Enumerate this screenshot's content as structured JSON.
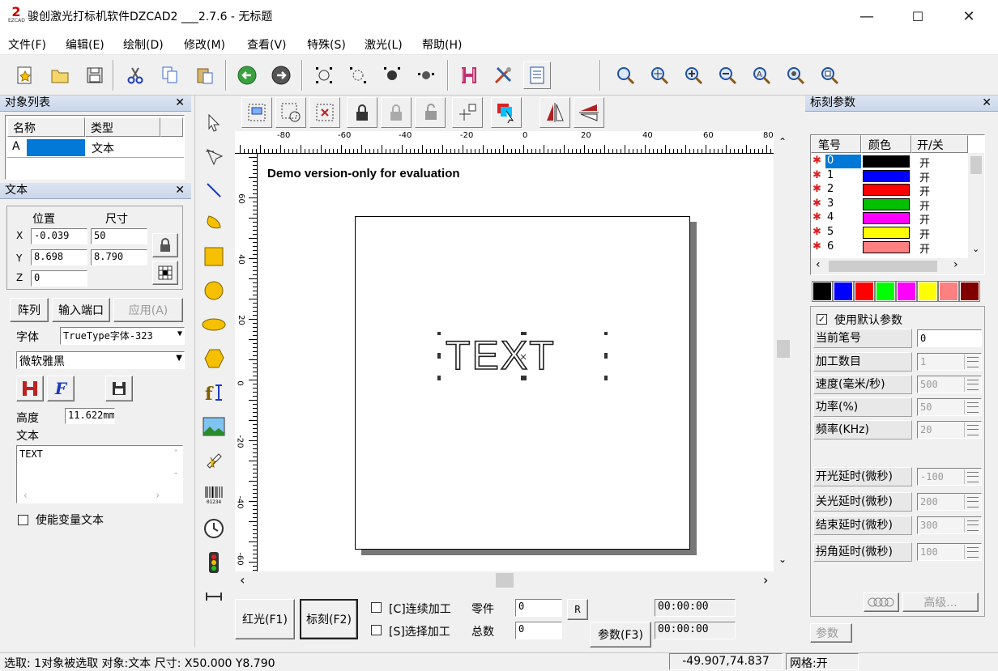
{
  "app": {
    "title": "骏创激光打标机软件DZCAD2 ___2.7.6 - 无标题",
    "logo_text": "EZCAD"
  },
  "window_buttons": {
    "minimize": "—",
    "maximize": "☐",
    "close": "✕"
  },
  "menu": [
    "文件(F)",
    "编辑(E)",
    "绘制(D)",
    "修改(M)",
    "查看(V)",
    "特殊(S)",
    "激光(L)",
    "帮助(H)"
  ],
  "object_list": {
    "title": "对象列表",
    "columns": [
      "名称",
      "类型"
    ],
    "rows": [
      {
        "name": "A",
        "type": "文本"
      }
    ]
  },
  "text_panel": {
    "title": "文本",
    "position_label": "位置",
    "size_label": "尺寸",
    "x_label": "X",
    "y_label": "Y",
    "z_label": "Z",
    "x_value": "-0.039",
    "y_value": "8.698",
    "z_value": "0",
    "size_x": "50",
    "size_y": "8.790",
    "array_button": "阵列",
    "input_port_button": "输入端口",
    "apply_button": "应用(A)",
    "font_label": "字体",
    "font_type": "TrueType字体-323",
    "font_name": "微软雅黑",
    "height_label": "高度",
    "height_value": "11.622mm",
    "text_label": "文本",
    "text_content": "TEXT",
    "variable_text_label": "使能变量文本"
  },
  "canvas": {
    "demo_text": "Demo version-only for evaluation",
    "object_text": "TEXT",
    "ruler_h": [
      "-80",
      "-60",
      "-40",
      "-20",
      "0",
      "20",
      "40",
      "60",
      "80"
    ],
    "ruler_v": [
      "60",
      "40",
      "20",
      "0",
      "-20",
      "-40",
      "-60"
    ]
  },
  "bottom": {
    "red_light_button": "红光(F1)",
    "mark_button": "标刻(F2)",
    "continuous_label": "[C]连续加工",
    "select_label": "[S]选择加工",
    "parts_label": "零件",
    "total_label": "总数",
    "parts_value": "0",
    "total_value": "0",
    "reset_button": "R",
    "params_button": "参数(F3)",
    "time1": "00:00:00",
    "time2": "00:00:00"
  },
  "marking_params": {
    "title": "标刻参数",
    "columns": [
      "笔号",
      "颜色",
      "开/关"
    ],
    "pens": [
      {
        "no": "0",
        "color": "#000000",
        "state": "开"
      },
      {
        "no": "1",
        "color": "#0000ff",
        "state": "开"
      },
      {
        "no": "2",
        "color": "#ff0000",
        "state": "开"
      },
      {
        "no": "3",
        "color": "#00c000",
        "state": "开"
      },
      {
        "no": "4",
        "color": "#ff00ff",
        "state": "开"
      },
      {
        "no": "5",
        "color": "#ffff00",
        "state": "开"
      },
      {
        "no": "6",
        "color": "#ff8080",
        "state": "开"
      }
    ],
    "swatches": [
      "#000000",
      "#0000ff",
      "#ff0000",
      "#00ff00",
      "#ff00ff",
      "#ffff00",
      "#ff8080",
      "#800000"
    ],
    "use_default_label": "使用默认参数",
    "fields": [
      {
        "label": "当前笔号",
        "value": "0"
      },
      {
        "label": "加工数目",
        "value": "1"
      },
      {
        "label": "速度(毫米/秒)",
        "value": "500"
      },
      {
        "label": "功率(%)",
        "value": "50"
      },
      {
        "label": "频率(KHz)",
        "value": "20"
      },
      {
        "label": "开光延时(微秒)",
        "value": "-100"
      },
      {
        "label": "关光延时(微秒)",
        "value": "200"
      },
      {
        "label": "结束延时(微秒)",
        "value": "300"
      },
      {
        "label": "拐角延时(微秒)",
        "value": "100"
      }
    ],
    "advanced_button": "高级...",
    "params_tab": "参数"
  },
  "status": {
    "selection": "选取: 1对象被选取 对象:文本 尺寸: X50.000 Y8.790",
    "coords": "-49.907,74.837",
    "grid": "网格:开"
  }
}
